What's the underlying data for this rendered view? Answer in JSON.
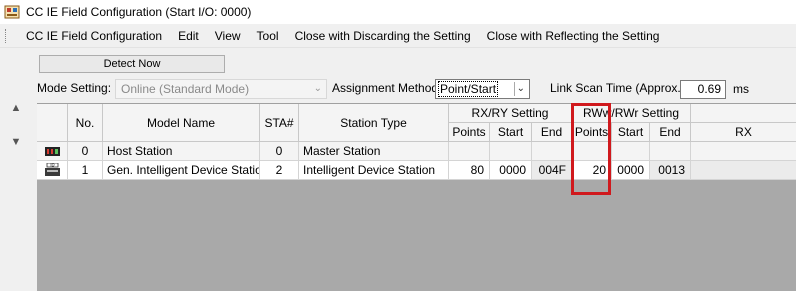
{
  "window": {
    "title": "CC IE Field Configuration (Start I/O: 0000)"
  },
  "menu": [
    "CC IE Field Configuration",
    "Edit",
    "View",
    "Tool",
    "Close with Discarding the Setting",
    "Close with Reflecting the Setting"
  ],
  "toolbar": {
    "detect_label": "Detect Now",
    "mode_label": "Mode Setting:",
    "mode_value": "Online (Standard Mode)",
    "assign_label": "Assignment Method:",
    "assign_value": "Point/Start",
    "scan_label": "Link Scan Time (Approx.):",
    "scan_value": "0.69",
    "scan_unit": "ms"
  },
  "table": {
    "headers": {
      "no": "No.",
      "model": "Model Name",
      "sta": "STA#",
      "type": "Station Type",
      "rxry": "RX/RY Setting",
      "rwwrwr": "RWw/RWr Setting",
      "points": "Points",
      "start": "Start",
      "end": "End",
      "rx": "RX"
    },
    "rows": [
      {
        "no": "0",
        "model": "Host Station",
        "sta": "0",
        "type": "Master Station",
        "rx_points": "",
        "rx_start": "",
        "rx_end": "",
        "rw_points": "",
        "rw_start": "",
        "rw_end": ""
      },
      {
        "no": "1",
        "model": "Gen. Intelligent Device Station",
        "sta": "2",
        "type": "Intelligent Device Station",
        "rx_points": "80",
        "rx_start": "0000",
        "rx_end": "004F",
        "rw_points": "20",
        "rw_start": "0000",
        "rw_end": "0013"
      }
    ]
  },
  "colors": {
    "highlight": "#d0191d",
    "grid_background": "#a9a9a9"
  }
}
